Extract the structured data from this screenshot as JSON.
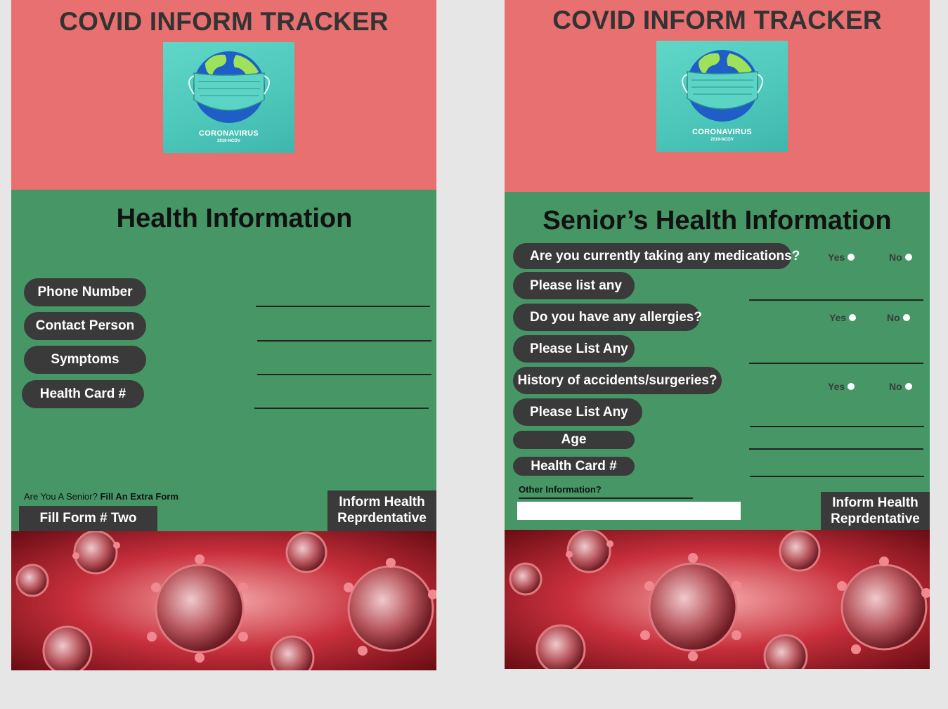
{
  "app_title": "COVID INFORM TRACKER",
  "logo": {
    "main": "CORONAVIRUS",
    "sub": "2019-NCOV"
  },
  "screen1": {
    "section_title": "Health Information",
    "fields": [
      "Phone Number",
      "Contact Person",
      "Symptoms",
      "Health Card #"
    ],
    "senior_prompt_question": "Are You A Senior?",
    "senior_prompt_action": "Fill An Extra Form",
    "fill_form_button": "Fill Form # Two",
    "inform_button_line1": "Inform Health",
    "inform_button_line2": "Reprdentative"
  },
  "screen2": {
    "section_title": "Senior’s Health Information",
    "questions": [
      "Are you currently taking any medications?",
      "Please list any",
      "Do you have any allergies?",
      "Please List Any",
      "History of accidents/surgeries?",
      "Please List Any",
      "Age",
      "Health Card #"
    ],
    "yes_label": "Yes",
    "no_label": "No",
    "other_info_label": "Other Information?",
    "other_info_value": "",
    "inform_button_line1": "Inform Health",
    "inform_button_line2": "Reprdentative"
  },
  "colors": {
    "header": "#e87070",
    "body": "#469765",
    "pill": "#3a3a3a",
    "background": "#e6e6e6"
  }
}
